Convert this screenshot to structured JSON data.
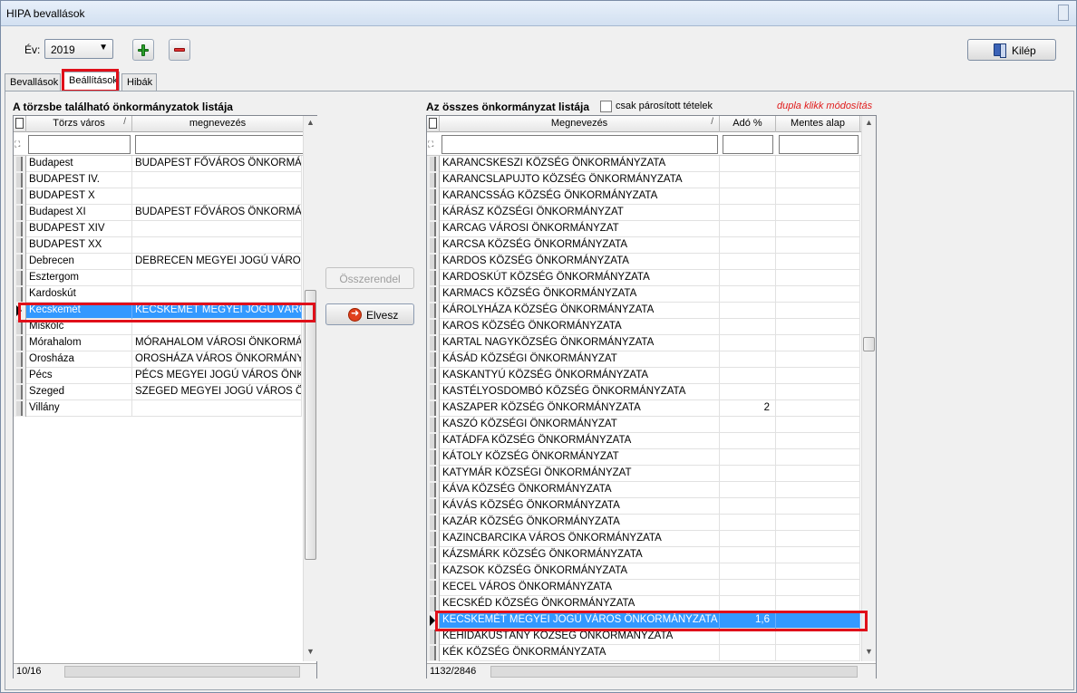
{
  "window": {
    "title": "HIPA bevallások"
  },
  "toolbar": {
    "year_label": "Év:",
    "year_value": "2019",
    "exit_label": "Kilép"
  },
  "tabs": [
    {
      "label": "Bevallások",
      "active": false
    },
    {
      "label": "Beállítások",
      "active": true
    },
    {
      "label": "Hibák",
      "active": false
    }
  ],
  "left": {
    "title": "A törzsbe található önkormányzatok listája",
    "columns": [
      "Törzs város",
      "megnevezés"
    ],
    "rows": [
      {
        "city": "Budapest",
        "name": "BUDAPEST FŐVÁROS ÖNKORMÁNY..."
      },
      {
        "city": "BUDAPEST IV.",
        "name": ""
      },
      {
        "city": "BUDAPEST X",
        "name": ""
      },
      {
        "city": "Budapest XI",
        "name": "BUDAPEST FŐVÁROS ÖNKORMÁNY..."
      },
      {
        "city": "BUDAPEST XIV",
        "name": ""
      },
      {
        "city": "BUDAPEST XX",
        "name": ""
      },
      {
        "city": "Debrecen",
        "name": "DEBRECEN MEGYEI JOGÚ VÁROS Ö..."
      },
      {
        "city": "Esztergom",
        "name": ""
      },
      {
        "city": "Kardoskút",
        "name": ""
      },
      {
        "city": "Kecskemét",
        "name": "KECSKEMÉT MEGYEI JOGÚ VÁROS ..."
      },
      {
        "city": "Miskolc",
        "name": ""
      },
      {
        "city": "Mórahalom",
        "name": "MÓRAHALOM VÁROSI ÖNKORMÁNY..."
      },
      {
        "city": "Orosháza",
        "name": "OROSHÁZA VÁROS ÖNKORMÁNYZA..."
      },
      {
        "city": "Pécs",
        "name": "PÉCS MEGYEI JOGÚ VÁROS ÖNKOR..."
      },
      {
        "city": "Szeged",
        "name": "SZEGED MEGYEI JOGÚ VÁROS ÖNK..."
      },
      {
        "city": "Villány",
        "name": ""
      }
    ],
    "selected_index": 9,
    "status": "10/16"
  },
  "middle": {
    "assign_label": "Összerendel",
    "remove_label": "Elvesz"
  },
  "right": {
    "title": "Az összes önkormányzat listája",
    "paired_only_label": "csak párosított tételek",
    "hint": "dupla klikk módosítás",
    "columns": [
      "Megnevezés",
      "Adó %",
      "Mentes alap"
    ],
    "rows": [
      {
        "name": "KARANCSKESZI KÖZSÉG ÖNKORMÁNYZATA",
        "tax": "",
        "exempt": ""
      },
      {
        "name": "KARANCSLAPUJTO KÖZSÉG ÖNKORMÁNYZATA",
        "tax": "",
        "exempt": ""
      },
      {
        "name": "KARANCSSÁG KÖZSÉG ÖNKORMÁNYZATA",
        "tax": "",
        "exempt": ""
      },
      {
        "name": "KÁRÁSZ KÖZSÉGI ÖNKORMÁNYZAT",
        "tax": "",
        "exempt": ""
      },
      {
        "name": "KARCAG VÁROSI ÖNKORMÁNYZAT",
        "tax": "",
        "exempt": ""
      },
      {
        "name": "KARCSA KÖZSÉG ÖNKORMÁNYZATA",
        "tax": "",
        "exempt": ""
      },
      {
        "name": "KARDOS KÖZSÉG ÖNKORMÁNYZATA",
        "tax": "",
        "exempt": ""
      },
      {
        "name": "KARDOSKÚT KÖZSÉG ÖNKORMÁNYZATA",
        "tax": "",
        "exempt": ""
      },
      {
        "name": "KARMACS KÖZSÉG ÖNKORMÁNYZATA",
        "tax": "",
        "exempt": ""
      },
      {
        "name": "KÁROLYHÁZA KÖZSÉG ÖNKORMÁNYZATA",
        "tax": "",
        "exempt": ""
      },
      {
        "name": "KAROS KÖZSÉG ÖNKORMÁNYZATA",
        "tax": "",
        "exempt": ""
      },
      {
        "name": "KARTAL NAGYKÖZSÉG ÖNKORMÁNYZATA",
        "tax": "",
        "exempt": ""
      },
      {
        "name": "KÁSÁD KÖZSÉGI ÖNKORMÁNYZAT",
        "tax": "",
        "exempt": ""
      },
      {
        "name": "KASKANTYÚ KÖZSÉG ÖNKORMÁNYZATA",
        "tax": "",
        "exempt": ""
      },
      {
        "name": "KASTÉLYOSDOMBÓ KÖZSÉG ÖNKORMÁNYZATA",
        "tax": "",
        "exempt": ""
      },
      {
        "name": "KASZAPER KÖZSÉG ÖNKORMÁNYZATA",
        "tax": "2",
        "exempt": ""
      },
      {
        "name": "KASZÓ KÖZSÉGI ÖNKORMÁNYZAT",
        "tax": "",
        "exempt": ""
      },
      {
        "name": "KATÁDFA KÖZSÉG ÖNKORMÁNYZATA",
        "tax": "",
        "exempt": ""
      },
      {
        "name": "KÁTOLY KÖZSÉG ÖNKORMÁNYZAT",
        "tax": "",
        "exempt": ""
      },
      {
        "name": "KATYMÁR KÖZSÉGI ÖNKORMÁNYZAT",
        "tax": "",
        "exempt": ""
      },
      {
        "name": "KÁVA KÖZSÉG ÖNKORMÁNYZATA",
        "tax": "",
        "exempt": ""
      },
      {
        "name": "KÁVÁS KÖZSÉG ÖNKORMÁNYZATA",
        "tax": "",
        "exempt": ""
      },
      {
        "name": "KAZÁR KÖZSÉG ÖNKORMÁNYZATA",
        "tax": "",
        "exempt": ""
      },
      {
        "name": "KAZINCBARCIKA VÁROS ÖNKORMÁNYZATA",
        "tax": "",
        "exempt": ""
      },
      {
        "name": "KÁZSMÁRK KÖZSÉG ÖNKORMÁNYZATA",
        "tax": "",
        "exempt": ""
      },
      {
        "name": "KAZSOK KÖZSÉG ÖNKORMÁNYZATA",
        "tax": "",
        "exempt": ""
      },
      {
        "name": "KECEL VÁROS ÖNKORMÁNYZATA",
        "tax": "",
        "exempt": ""
      },
      {
        "name": "KECSKÉD KÖZSÉG ÖNKORMÁNYZATA",
        "tax": "",
        "exempt": ""
      },
      {
        "name": "KECSKEMÉT MEGYEI JOGÚ VÁROS ÖNKORMÁNYZATA",
        "tax": "1,6",
        "exempt": ""
      },
      {
        "name": "KEHIDAKUSTÁNY KÖZSÉG ÖNKORMÁNYZATA",
        "tax": "",
        "exempt": ""
      },
      {
        "name": "KÉK KÖZSÉG ÖNKORMÁNYZATA",
        "tax": "",
        "exempt": ""
      }
    ],
    "selected_index": 28,
    "status": "1132/2846"
  },
  "colors": {
    "selection": "#3399ff",
    "highlight": "#e0101a"
  },
  "icons": {
    "add": "plus-icon",
    "remove": "minus-icon",
    "exit": "door-icon",
    "take": "arrow-right-icon"
  }
}
